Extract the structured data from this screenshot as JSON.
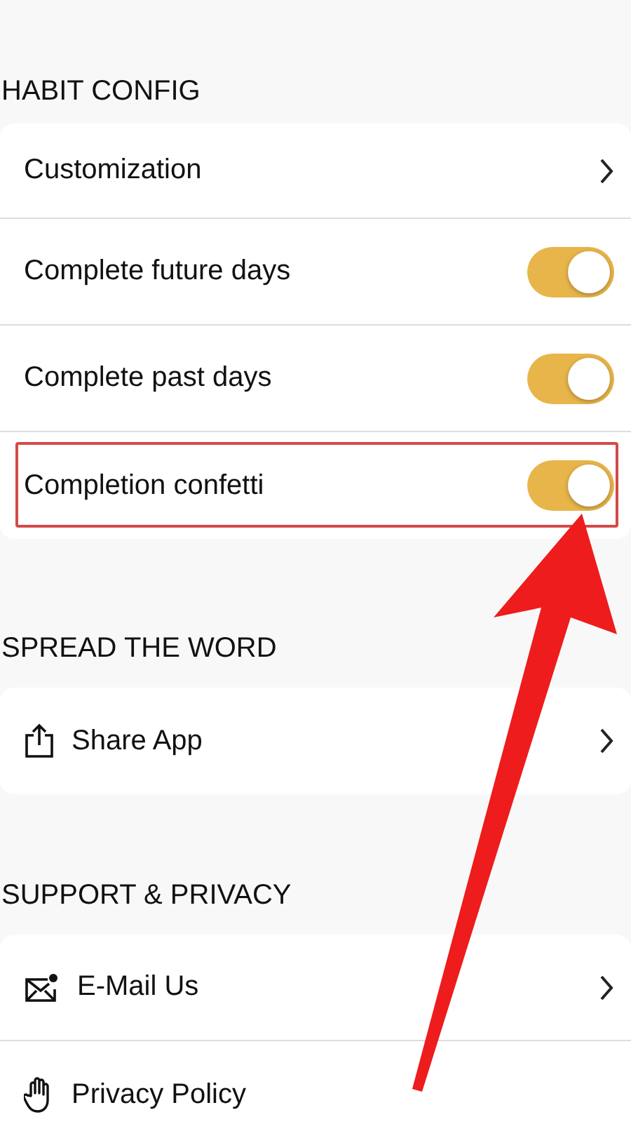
{
  "sections": [
    {
      "title": "HABIT CONFIG",
      "items": [
        {
          "kind": "link",
          "label": "Customization",
          "highlighted": false
        },
        {
          "kind": "toggle",
          "label": "Complete future days",
          "on": true,
          "highlighted": false
        },
        {
          "kind": "toggle",
          "label": "Complete past days",
          "on": true,
          "highlighted": false
        },
        {
          "kind": "toggle",
          "label": "Completion confetti",
          "on": true,
          "highlighted": true
        }
      ]
    },
    {
      "title": "SPREAD THE WORD",
      "items": [
        {
          "kind": "link",
          "label": "Share App",
          "highlighted": false
        }
      ]
    },
    {
      "title": "SUPPORT & PRIVACY",
      "items": [
        {
          "kind": "link",
          "label": "E-Mail Us",
          "highlighted": false
        },
        {
          "kind": "plain",
          "label": "Privacy Policy",
          "highlighted": false
        }
      ]
    }
  ],
  "pointer_arrow": true
}
